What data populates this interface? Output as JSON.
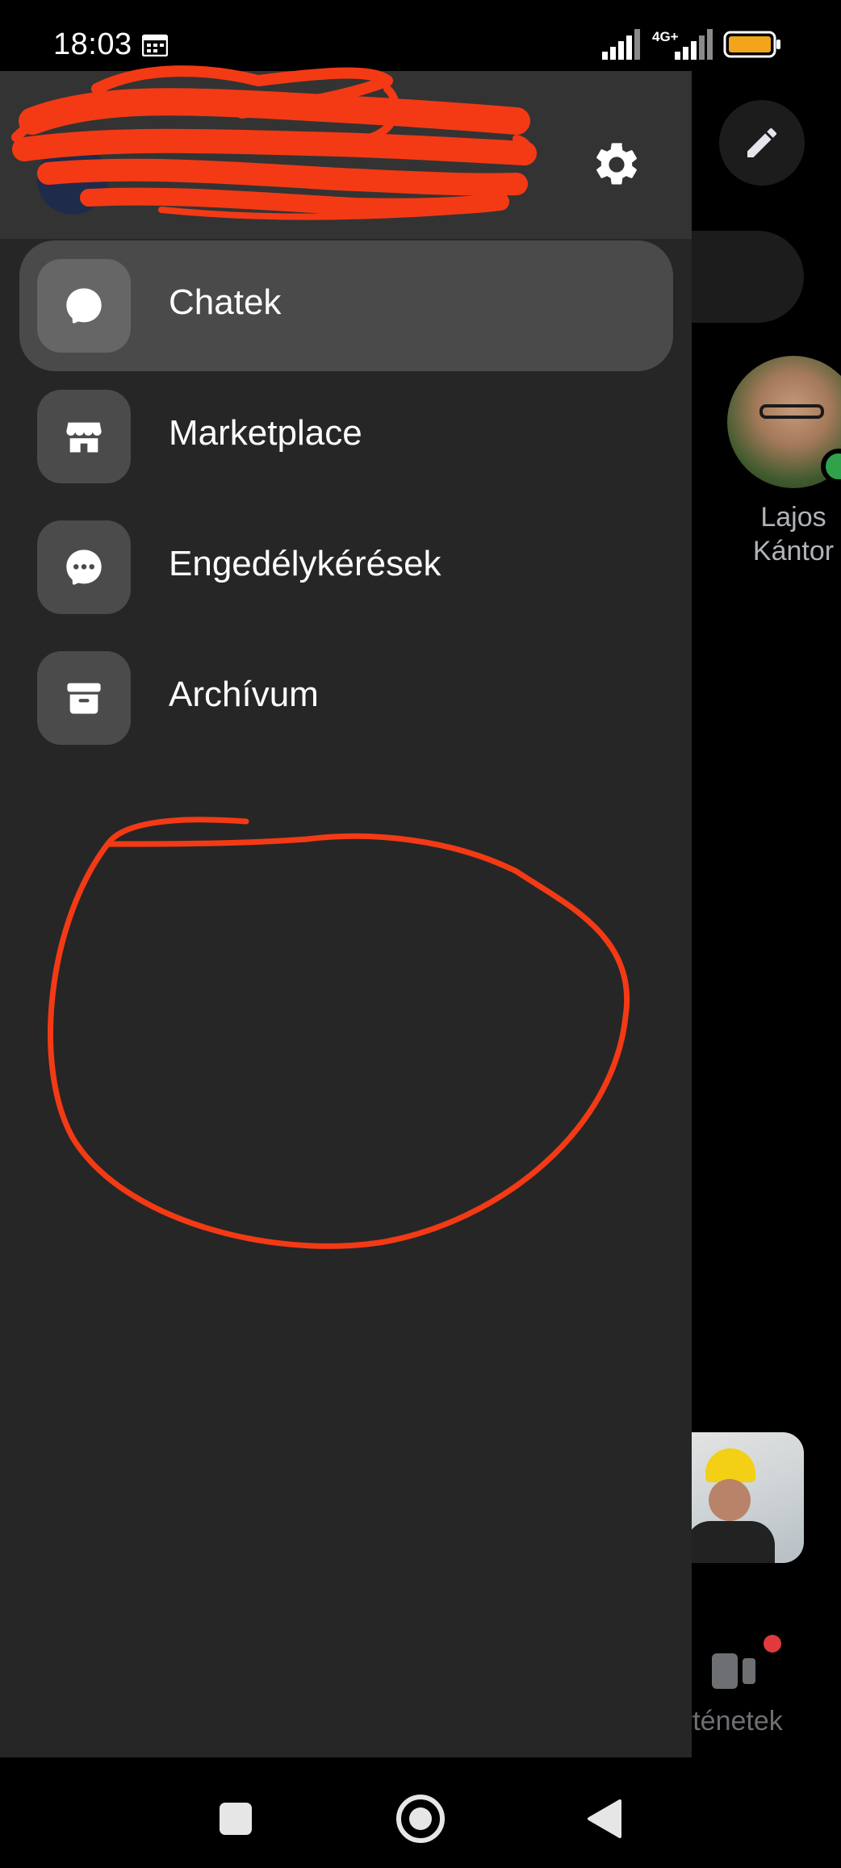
{
  "status_bar": {
    "time": "18:03",
    "network_type": "4G+",
    "icons": [
      "calendar-icon",
      "signal-icon",
      "signal-icon",
      "battery-icon"
    ],
    "battery_color": "#f2a51a"
  },
  "drawer": {
    "settings_icon": "gear-icon",
    "menu": [
      {
        "label": "Chatek",
        "icon": "chat-bubble-icon",
        "active": true
      },
      {
        "label": "Marketplace",
        "icon": "storefront-icon",
        "active": false
      },
      {
        "label": "Engedélykérések",
        "icon": "chat-dots-icon",
        "active": false
      },
      {
        "label": "Archívum",
        "icon": "archive-box-icon",
        "active": false
      }
    ]
  },
  "background": {
    "compose_icon": "pencil-icon",
    "contact": {
      "name": "Lajos Kántor",
      "online": true
    },
    "stories_label": "örténetek",
    "stories_badge_color": "#e0393e"
  },
  "navbar": {
    "buttons": [
      "recents-square-icon",
      "home-circle-icon",
      "back-triangle-icon"
    ]
  },
  "annotation_color": "#f33a15"
}
